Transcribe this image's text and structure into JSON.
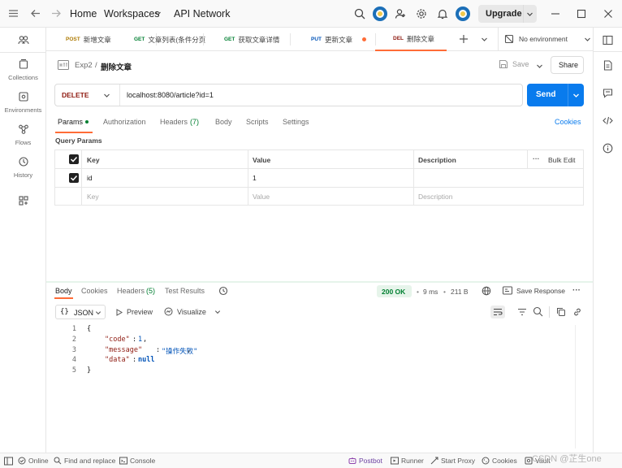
{
  "topbar": {
    "home": "Home",
    "workspaces": "Workspaces",
    "api_network": "API Network",
    "upgrade": "Upgrade"
  },
  "sidebar": {
    "items": [
      {
        "label": "Collections"
      },
      {
        "label": "Environments"
      },
      {
        "label": "Flows"
      },
      {
        "label": "History"
      }
    ]
  },
  "tabs": [
    {
      "method": "POST",
      "title": "新增文章",
      "color": "#ad7a03"
    },
    {
      "method": "GET",
      "title": "文章列表(条件分页",
      "color": "#007f31"
    },
    {
      "method": "GET",
      "title": "获取文章详情",
      "color": "#007f31"
    },
    {
      "method": "PUT",
      "title": "更新文章",
      "color": "#0053b8"
    },
    {
      "method": "DEL",
      "title": "删除文章",
      "color": "#8e1a10"
    }
  ],
  "environment": "No environment",
  "breadcrumb": {
    "parent": "Exp2",
    "separator": "/",
    "current": "删除文章"
  },
  "actions": {
    "save": "Save",
    "share": "Share"
  },
  "request": {
    "method": "DELETE",
    "url": "localhost:8080/article?id=1",
    "send": "Send"
  },
  "request_tabs": {
    "params": "Params",
    "authorization": "Authorization",
    "headers": "Headers",
    "headers_count": "(7)",
    "body": "Body",
    "scripts": "Scripts",
    "settings": "Settings",
    "cookies": "Cookies"
  },
  "query_params": {
    "title": "Query Params",
    "columns": [
      "Key",
      "Value",
      "Description"
    ],
    "bulk_edit": "Bulk Edit",
    "rows": [
      {
        "key": "id",
        "value": "1",
        "description": ""
      }
    ],
    "placeholder": {
      "key": "Key",
      "value": "Value",
      "description": "Description"
    }
  },
  "response": {
    "tabs": {
      "body": "Body",
      "cookies": "Cookies",
      "headers": "Headers",
      "headers_count": "(5)",
      "test_results": "Test Results"
    },
    "status": "200 OK",
    "time": "9 ms",
    "size": "211 B",
    "save_response": "Save Response",
    "format": "JSON",
    "preview": "Preview",
    "visualize": "Visualize",
    "lines": [
      {
        "num": "1",
        "text": "{"
      },
      {
        "num": "2",
        "key": "\"code\"",
        "value": "1",
        "suffix": ","
      },
      {
        "num": "3",
        "key": "\"message\"",
        "value": "\"操作失败\"",
        "suffix": ","
      },
      {
        "num": "4",
        "key": "\"data\"",
        "value": "null",
        "suffix": ""
      },
      {
        "num": "5",
        "text": "}"
      }
    ]
  },
  "statusbar": {
    "online": "Online",
    "find_replace": "Find and replace",
    "console": "Console",
    "postbot": "Postbot",
    "runner": "Runner",
    "start_proxy": "Start Proxy",
    "cookies": "Cookies",
    "vault": "Vault",
    "watermark": "CSDN @芷生one"
  },
  "colors": {
    "accent": "#ff6c37",
    "send": "#097bed",
    "delete_method": "#8e1a10",
    "status_ok": "#007f31",
    "json_key": "#8e1a10",
    "json_value": "#0053b8"
  }
}
